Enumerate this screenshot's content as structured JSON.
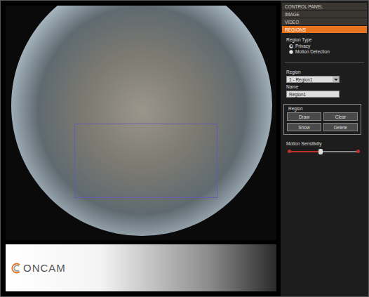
{
  "menu": [
    {
      "label": "CONTROL PANEL",
      "selected": false
    },
    {
      "label": "IMAGE",
      "selected": false
    },
    {
      "label": "VIDEO",
      "selected": false
    },
    {
      "label": "REGIONS",
      "selected": true
    }
  ],
  "region_type": {
    "label": "Region Type",
    "options": [
      {
        "label": "Privacy",
        "selected": true
      },
      {
        "label": "Motion Detection",
        "selected": false
      }
    ]
  },
  "region_select": {
    "label": "Region",
    "value": "1 - Region1"
  },
  "name_field": {
    "label": "Name",
    "value": "Region1"
  },
  "region_group": {
    "title": "Region",
    "buttons": [
      "Draw",
      "Clear",
      "Show",
      "Delete"
    ]
  },
  "motion_sensitivity": {
    "label": "Motion Sensitivity",
    "level": 0.45
  },
  "logo": {
    "text": "ONCAM"
  }
}
